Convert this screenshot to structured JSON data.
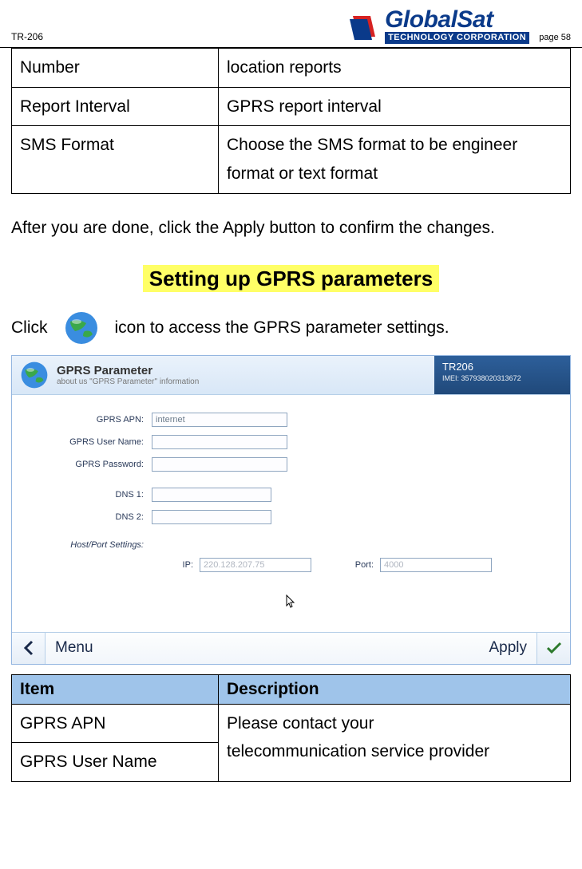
{
  "header": {
    "doc_id": "TR-206",
    "brand": "GlobalSat",
    "brand_sub": "TECHNOLOGY CORPORATION",
    "page_number": "page 58"
  },
  "top_table": {
    "rows": [
      {
        "c1": "Number",
        "c2": "location reports"
      },
      {
        "c1": "Report Interval",
        "c2": "GPRS report interval"
      },
      {
        "c1": "SMS Format",
        "c2": "Choose the SMS format to be engineer format or text format"
      }
    ]
  },
  "body_text": "After you are done, click the Apply button to confirm the changes.",
  "section_title": "Setting up GPRS parameters",
  "click_line_pre": "Click",
  "click_line_post": "icon to access the GPRS parameter settings.",
  "panel": {
    "title": "GPRS Parameter",
    "subtitle": "about us \"GPRS Parameter\" information",
    "device": "TR206",
    "imei": "IMEI: 357938020313672",
    "fields": {
      "apn_label": "GPRS APN:",
      "apn_value": "internet",
      "user_label": "GPRS User Name:",
      "user_value": "",
      "pass_label": "GPRS Password:",
      "pass_value": "",
      "dns1_label": "DNS 1:",
      "dns1_value": "",
      "dns2_label": "DNS 2:",
      "dns2_value": "",
      "host_label": "Host/Port Settings:",
      "ip_label": "IP:",
      "ip_value": "220.128.207.75",
      "port_label": "Port:",
      "port_value": "4000"
    },
    "footer": {
      "menu": "Menu",
      "apply": "Apply"
    }
  },
  "desc_table": {
    "header_item": "Item",
    "header_desc": "Description",
    "r1_item": "GPRS APN",
    "r2_item": "GPRS User Name",
    "desc_line1": "Please contact your",
    "desc_line2": "telecommunication service provider"
  }
}
